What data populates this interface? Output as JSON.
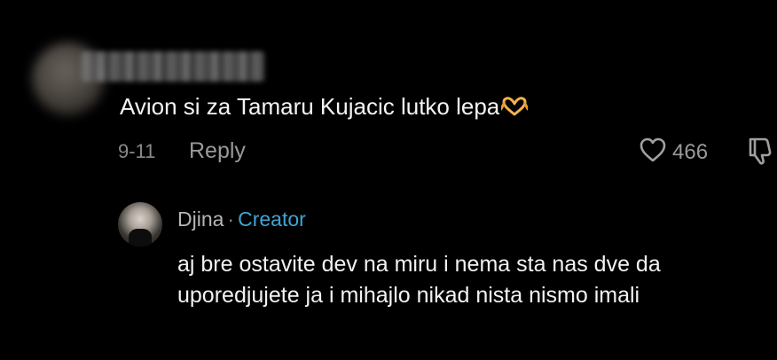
{
  "comment": {
    "text": "Avion si za Tamaru Kujacic lutko lepa",
    "emoji_icon": "heart-hands-icon",
    "date": "9-11",
    "reply_label": "Reply",
    "likes": "466"
  },
  "reply": {
    "author": "Djina",
    "separator": "·",
    "badge": "Creator",
    "text": "aj bre ostavite dev na miru i nema sta nas dve da uporedjujete ja i mihajlo nikad nista nismo imali"
  },
  "colors": {
    "background": "#000000",
    "creator_badge": "#3fa5d6",
    "muted_text": "#9a9a9a",
    "emoji": "#f4b24a"
  }
}
